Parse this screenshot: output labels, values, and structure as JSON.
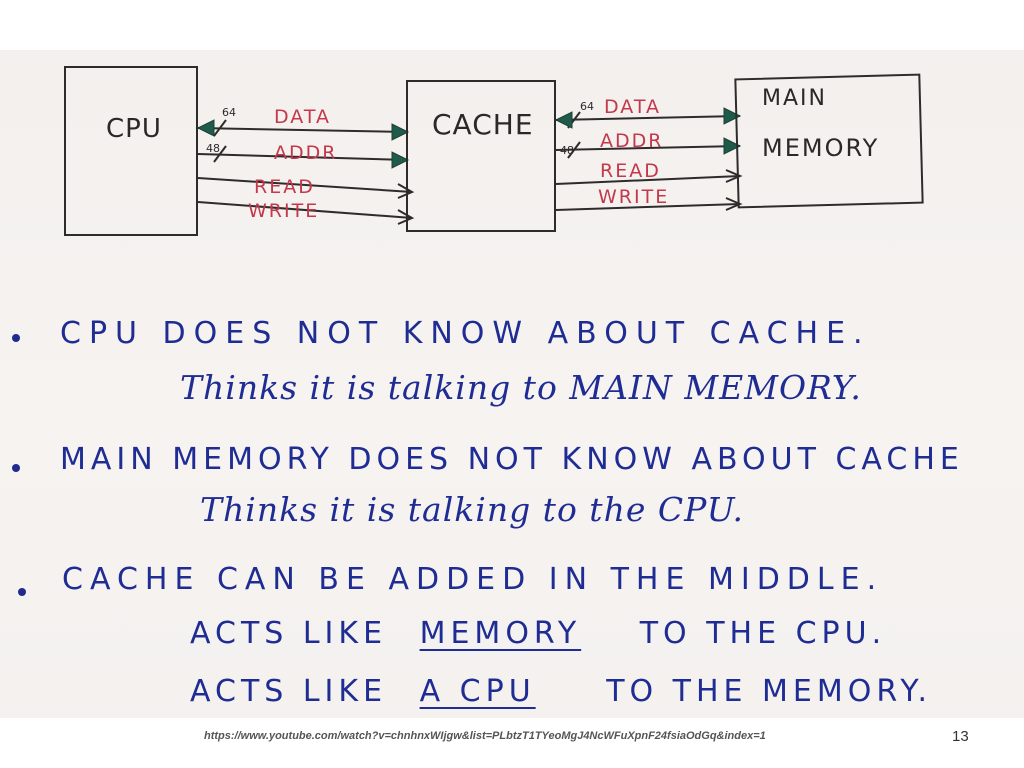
{
  "diagram": {
    "blocks": {
      "cpu": "CPU",
      "cache": "CACHE",
      "main_memory_line1": "MAIN",
      "main_memory_line2": "MEMORY"
    },
    "left_bus": {
      "data": "DATA",
      "addr": "ADDR",
      "read": "READ",
      "write": "WRITE",
      "data_width": "64",
      "addr_width": "48"
    },
    "right_bus": {
      "data": "DATA",
      "addr": "ADDR",
      "read": "READ",
      "write": "WRITE",
      "data_width": "64",
      "addr_width": "48"
    },
    "colors": {
      "box_ink": "#2d2b2c",
      "signal_ink": "#c4384b",
      "note_ink": "#1e2c93"
    }
  },
  "notes": [
    {
      "headline": "CPU DOES NOT KNOW ABOUT CACHE.",
      "detail": "Thinks it is talking to MAIN MEMORY."
    },
    {
      "headline": "MAIN MEMORY DOES NOT KNOW ABOUT CACHE",
      "detail": "Thinks it is talking to the CPU."
    },
    {
      "headline": "CACHE CAN BE ADDED IN THE MIDDLE.",
      "line2_prefix": "ACTS LIKE",
      "line2_underlined": "MEMORY",
      "line2_suffix": "TO THE CPU.",
      "line3_prefix": "ACTS LIKE",
      "line3_underlined": "A CPU",
      "line3_suffix": "TO THE MEMORY."
    }
  ],
  "footer": {
    "url": "https://www.youtube.com/watch?v=chnhnxWIjgw&list=PLbtzT1TYeoMgJ4NcWFuXpnF24fsiaOdGq&index=1",
    "page_number": "13"
  }
}
